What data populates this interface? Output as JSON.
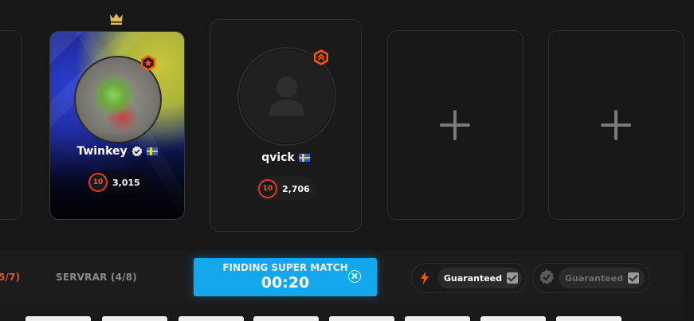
{
  "party": {
    "leader": {
      "name": "Twinkey",
      "level": "10",
      "elo": "3,015",
      "country": "Sweden"
    },
    "member": {
      "name": "qvick",
      "level": "10",
      "elo": "2,706",
      "country": "Sweden"
    }
  },
  "tabs": {
    "left_partial": "5/7)",
    "servers": "SERVRAR (4/8)"
  },
  "matchmaking": {
    "status": "FINDING SUPER MATCH",
    "timer": "00:20"
  },
  "options": {
    "guaranteed_1": "Guaranteed",
    "guaranteed_2": "Guaranteed"
  },
  "colors": {
    "accent_orange": "#ff5500",
    "accent_blue": "#13a8ee",
    "crown_gold": "#e2b85a"
  },
  "icons": [
    "crown-icon",
    "rank-star-icon",
    "rank-chevron-icon",
    "verified-icon",
    "sweden-flag-icon",
    "plus-icon",
    "lightning-icon",
    "shield-check-icon",
    "close-icon"
  ]
}
